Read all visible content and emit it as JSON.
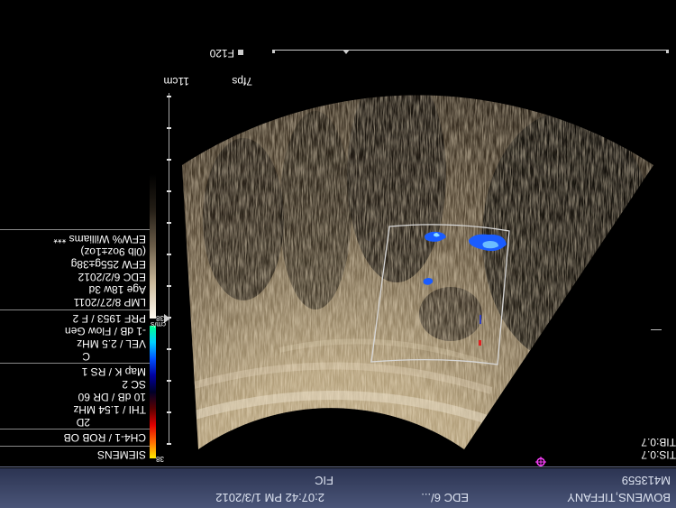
{
  "patient_bar": {
    "name": "BOWENS,TIFFANY",
    "edc": "EDC 6/...",
    "datetime": "2:07:42 PM 1/3/2012",
    "mrn": "M413559",
    "label": "FIC"
  },
  "thermal": {
    "tis": "TIS:0.7",
    "tib": "TIB:0.7"
  },
  "device": {
    "brand": "SIEMENS",
    "probe": "CH4-1 / ROB OB",
    "mode_2d_label": "2D",
    "thi": "THI / 1.54 MHz",
    "gain_dr": "10 dB / DR 60",
    "sc": "SC 2",
    "map": "Map K / RS 1",
    "mode_c_label": "C",
    "vel": "VEL / 2.5 MHz",
    "flow": "-1 dB / Flow Gen",
    "prf": "PRF 1953 / F 2",
    "lmp": "LMP 8/27/2011",
    "age": "Age 18w 3d",
    "edc": "EDC 6/2/2012",
    "efw": "EFW 255g±38g",
    "efw_lb": "(0lb 9oz±1oz)",
    "efw_pct": "EFW% Williams ***"
  },
  "colorbar": {
    "cms_top": "38",
    "cms_unit": "cm/s",
    "cms_bottom": "38"
  },
  "imaging": {
    "frame_rate": "7fps",
    "depth": "11cm",
    "focus_label": "F120"
  },
  "colors": {
    "bar_top": "#4a5578",
    "bar_bottom": "#2c3452",
    "flow_blue": "#1a5cff",
    "flow_red": "#e02020",
    "roi_box": "#d8d8d8"
  },
  "icons": {
    "orientation": "siemens-orientation-marker",
    "focus": "focal-zone-triangle"
  }
}
